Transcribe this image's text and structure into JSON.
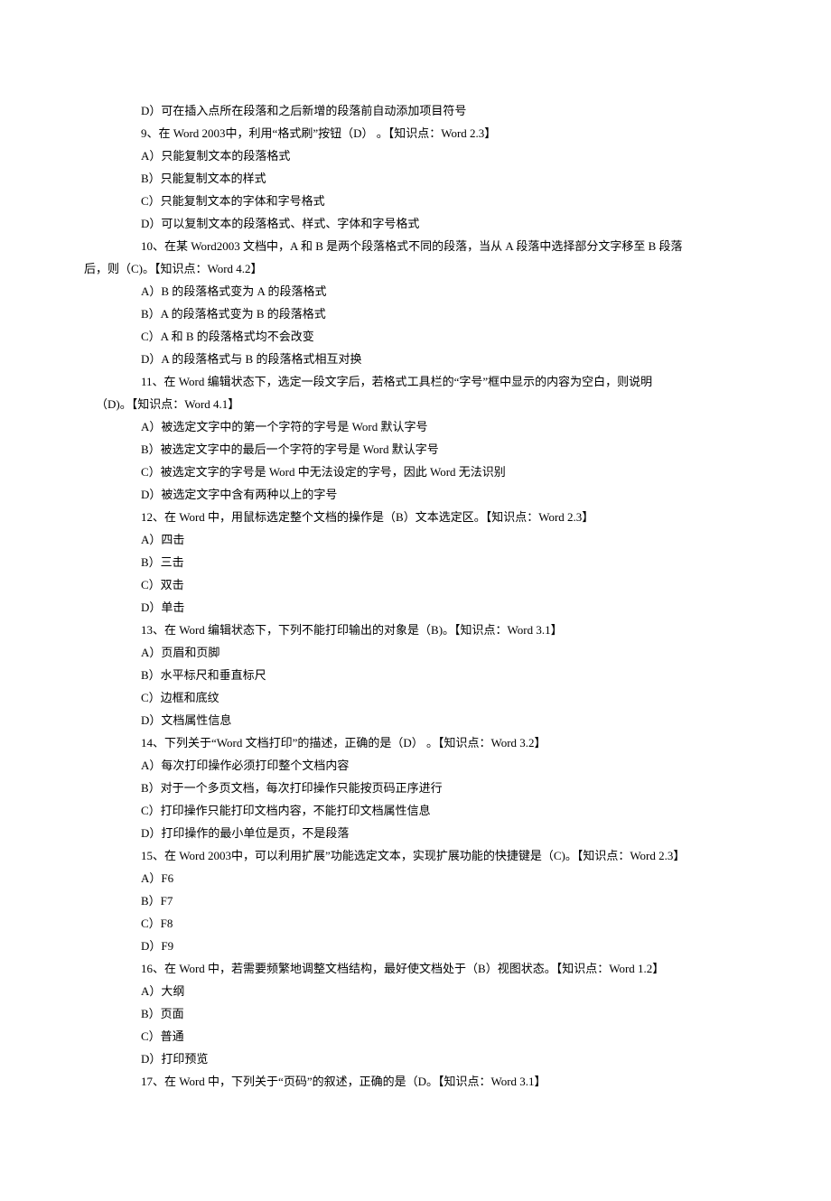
{
  "lines": [
    {
      "cls": "indent-opt",
      "t": "D）可在插入点所在段落和之后新增的段落前自动添加项目符号"
    },
    {
      "cls": "indent-q",
      "t": "9、在 Word 2003中，利用“格式刷”按钮（D） 。【知识点：Word 2.3】"
    },
    {
      "cls": "indent-opt",
      "t": "A）只能复制文本的段落格式"
    },
    {
      "cls": "indent-opt",
      "t": "B）只能复制文本的样式"
    },
    {
      "cls": "indent-opt",
      "t": "C）只能复制文本的字体和字号格式"
    },
    {
      "cls": "indent-opt",
      "t": "D）可以复制文本的段落格式、样式、字体和字号格式"
    },
    {
      "cls": "indent-q",
      "t": "10、在某 Word2003 文档中，A 和 B 是两个段落格式不同的段落，当从 A 段落中选择部分文字移至 B 段落"
    },
    {
      "cls": "indent-wrap",
      "t": "后，则（C)。【知识点：Word 4.2】"
    },
    {
      "cls": "indent-opt",
      "t": "A）B 的段落格式变为 A 的段落格式"
    },
    {
      "cls": "indent-opt",
      "t": "B）A 的段落格式变为 B 的段落格式"
    },
    {
      "cls": "indent-opt",
      "t": "C）A 和 B 的段落格式均不会改变"
    },
    {
      "cls": "indent-opt",
      "t": "D）A 的段落格式与 B 的段落格式相互对换"
    },
    {
      "cls": "indent-q",
      "t": "11、在 Word 编辑状态下，选定一段文字后，若格式工具栏的“字号”框中显示的内容为空白，则说明"
    },
    {
      "cls": "indent-wrap2",
      "t": "（D)。【知识点：Word 4.1】"
    },
    {
      "cls": "indent-opt",
      "t": "A）被选定文字中的第一个字符的字号是 Word 默认字号"
    },
    {
      "cls": "indent-opt",
      "t": "B）被选定文字中的最后一个字符的字号是 Word 默认字号"
    },
    {
      "cls": "indent-opt",
      "t": "C）被选定文字的字号是 Word 中无法设定的字号，因此 Word 无法识别"
    },
    {
      "cls": "indent-opt",
      "t": "D）被选定文字中含有两种以上的字号"
    },
    {
      "cls": "indent-q",
      "t": "12、在 Word 中，用鼠标选定整个文档的操作是（B）文本选定区。【知识点：Word 2.3】"
    },
    {
      "cls": "indent-opt",
      "t": "A）四击"
    },
    {
      "cls": "indent-opt",
      "t": "B）三击"
    },
    {
      "cls": "indent-opt",
      "t": "C）双击"
    },
    {
      "cls": "indent-opt",
      "t": "D）单击"
    },
    {
      "cls": "indent-q",
      "t": "13、在 Word 编辑状态下，下列不能打印输出的对象是（B)。【知识点：Word 3.1】"
    },
    {
      "cls": "indent-opt",
      "t": "A）页眉和页脚"
    },
    {
      "cls": "indent-opt",
      "t": "B）水平标尺和垂直标尺"
    },
    {
      "cls": "indent-opt",
      "t": "C）边框和底纹"
    },
    {
      "cls": "indent-opt",
      "t": "D）文档属性信息"
    },
    {
      "cls": "indent-q",
      "t": "14、下列关于“Word 文档打印”的描述，正确的是（D） 。【知识点：Word 3.2】"
    },
    {
      "cls": "indent-opt",
      "t": "A）每次打印操作必须打印整个文档内容"
    },
    {
      "cls": "indent-opt",
      "t": "B）对于一个多页文档，每次打印操作只能按页码正序进行"
    },
    {
      "cls": "indent-opt",
      "t": "C）打印操作只能打印文档内容，不能打印文档属性信息"
    },
    {
      "cls": "indent-opt",
      "t": "D）打印操作的最小单位是页，不是段落"
    },
    {
      "cls": "indent-q",
      "t": "15、在 Word 2003中，可以利用扩展”功能选定文本，实现扩展功能的快捷键是（C)。【知识点：Word 2.3】"
    },
    {
      "cls": "indent-opt",
      "t": "A）F6"
    },
    {
      "cls": "indent-opt",
      "t": "B）F7"
    },
    {
      "cls": "indent-opt",
      "t": "C）F8"
    },
    {
      "cls": "indent-opt",
      "t": "D）F9"
    },
    {
      "cls": "indent-q",
      "t": "16、在 Word 中，若需要频繁地调整文档结构，最好使文档处于（B）视图状态。【知识点：Word 1.2】"
    },
    {
      "cls": "indent-opt",
      "t": "A）大纲"
    },
    {
      "cls": "indent-opt",
      "t": "B）页面"
    },
    {
      "cls": "indent-opt",
      "t": "C）普通"
    },
    {
      "cls": "indent-opt",
      "t": "D）打印预览"
    },
    {
      "cls": "indent-q",
      "t": "17、在 Word 中，下列关于“页码”的叙述，正确的是（D。【知识点：Word 3.1】"
    }
  ]
}
